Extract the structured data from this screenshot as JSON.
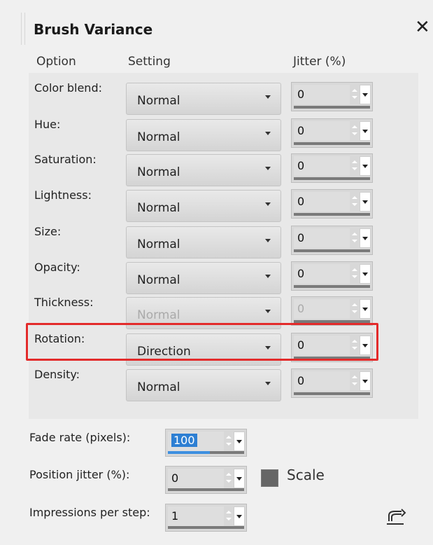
{
  "panel": {
    "title": "Brush Variance",
    "close_icon": "close-icon"
  },
  "columns": {
    "option": "Option",
    "setting": "Setting",
    "jitter": "Jitter (%)"
  },
  "rows": [
    {
      "label": "Color blend:",
      "setting": "Normal",
      "jitter": "0",
      "enabled": true
    },
    {
      "label": "Hue:",
      "setting": "Normal",
      "jitter": "0",
      "enabled": true
    },
    {
      "label": "Saturation:",
      "setting": "Normal",
      "jitter": "0",
      "enabled": true
    },
    {
      "label": "Lightness:",
      "setting": "Normal",
      "jitter": "0",
      "enabled": true
    },
    {
      "label": "Size:",
      "setting": "Normal",
      "jitter": "0",
      "enabled": true
    },
    {
      "label": "Opacity:",
      "setting": "Normal",
      "jitter": "0",
      "enabled": true
    },
    {
      "label": "Thickness:",
      "setting": "Normal",
      "jitter": "0",
      "enabled": false
    },
    {
      "label": "Rotation:",
      "setting": "Direction",
      "jitter": "0",
      "enabled": true
    },
    {
      "label": "Density:",
      "setting": "Normal",
      "jitter": "0",
      "enabled": true
    }
  ],
  "bottom": {
    "fade_rate_label": "Fade rate (pixels):",
    "fade_rate_value": "100",
    "position_jitter_label": "Position jitter (%):",
    "position_jitter_value": "0",
    "impressions_label": "Impressions per step:",
    "impressions_value": "1",
    "scale_label": "Scale",
    "reset_icon": "reset-icon"
  },
  "colors": {
    "highlight": "#e32b2b",
    "selection": "#2d7fd3"
  }
}
